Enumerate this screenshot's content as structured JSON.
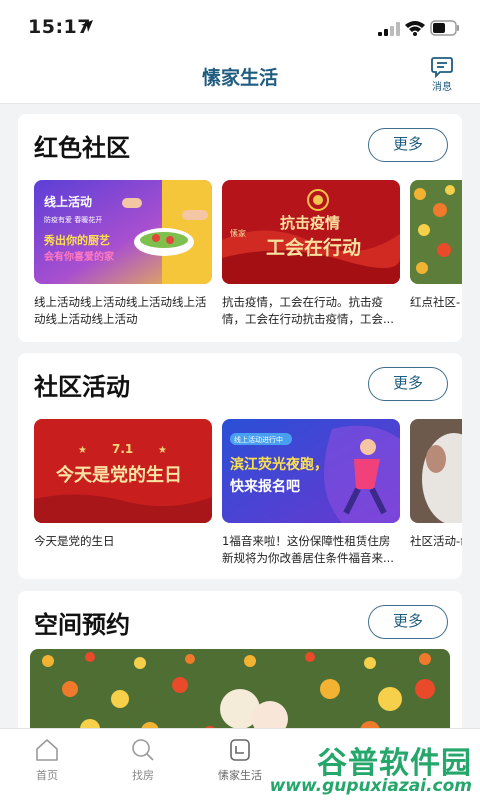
{
  "status": {
    "time": "15:17"
  },
  "header": {
    "title": "愫家生活",
    "message_label": "消息"
  },
  "sections": [
    {
      "title": "红色社区",
      "more": "更多",
      "items": [
        {
          "caption": "线上活动线上活动线上活动线上活动线上活动线上活动",
          "thumb_text": [
            "线上活动",
            "防疫有爱 春暖花开",
            "秀出你的厨艺",
            "会有你喜爱的家"
          ]
        },
        {
          "caption": "抗击疫情，工会在行动。抗击疫情，工会在行动抗击疫情，工会...",
          "thumb_text": [
            "抗击疫情",
            "工会在行动",
            "愫家"
          ]
        },
        {
          "caption": "红点社区-"
        }
      ]
    },
    {
      "title": "社区活动",
      "more": "更多",
      "items": [
        {
          "caption": "今天是党的生日",
          "thumb_text": [
            "7.1",
            "今天是党的生日"
          ]
        },
        {
          "caption": "1福音来啦！这份保障性租赁住房新规将为你改善居住条件福音来...",
          "thumb_text": [
            "线上活动进行中",
            "滨江荧光夜跑，",
            "快来报名吧"
          ]
        },
        {
          "caption": "社区活动-命精神"
        }
      ]
    },
    {
      "title": "空间预约",
      "more": "更多"
    }
  ],
  "tabs": [
    {
      "label": "首页",
      "icon": "home-icon"
    },
    {
      "label": "找房",
      "icon": "search-icon"
    },
    {
      "label": "愫家生活",
      "icon": "life-icon"
    }
  ],
  "watermark": {
    "big": "谷普软件园",
    "small": "www.gupuxiazai.com"
  },
  "colors": {
    "brand": "#1f5c80",
    "background": "#f2f3f5",
    "red": "#c81e1e"
  }
}
